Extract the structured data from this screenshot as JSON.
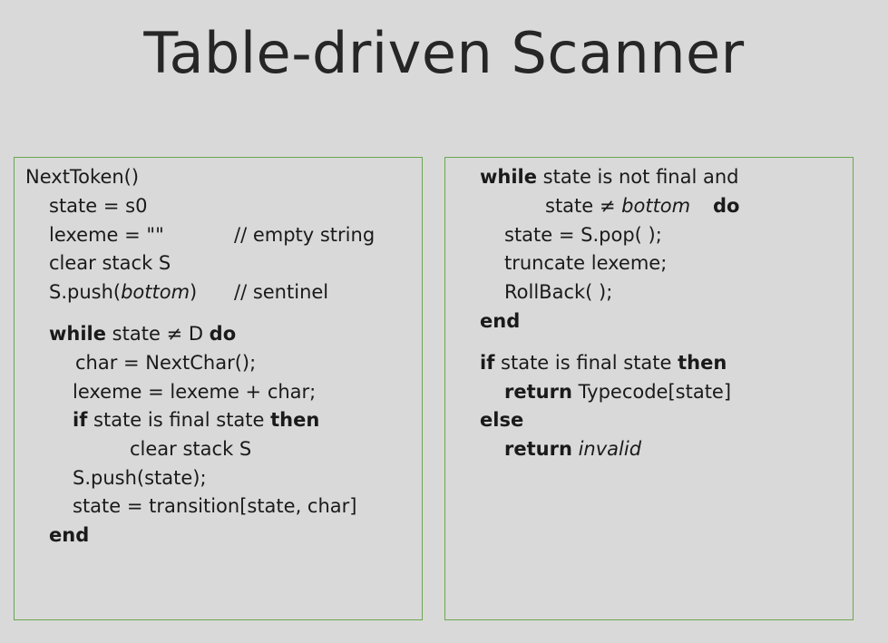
{
  "slide": {
    "title": "Table-driven Scanner"
  },
  "left": {
    "l1": "NextToken()",
    "l2": "state = s0",
    "l3": "lexeme = \"\"",
    "l3_comment": "// empty string",
    "l4": "clear stack S",
    "l5a": "S.push(",
    "l5b": "bottom",
    "l5c": ")",
    "l5_comment": "// sentinel",
    "l6a": "while",
    "l6b": " state ≠ D ",
    "l6c": "do",
    "l7": "char = NextChar();",
    "l8": "lexeme = lexeme + char;",
    "l9a": "if",
    "l9b": " state is final state ",
    "l9c": "then",
    "l10": "clear stack S",
    "l11": "S.push(state);",
    "l12": "state = transition[state, char]",
    "l13": "end"
  },
  "right": {
    "r1a": "while",
    "r1b": " state is not final and",
    "r2a": "state ≠ ",
    "r2b": "bottom",
    "r2c": "do",
    "r3": "state = S.pop( );",
    "r4": "truncate lexeme;",
    "r5": "RollBack( );",
    "r6": "end",
    "r7a": "if",
    "r7b": " state is final state ",
    "r7c": "then",
    "r8a": "return",
    "r8b": " Typecode[state]",
    "r9": "else",
    "r10a": "return",
    "r10b": "invalid"
  }
}
